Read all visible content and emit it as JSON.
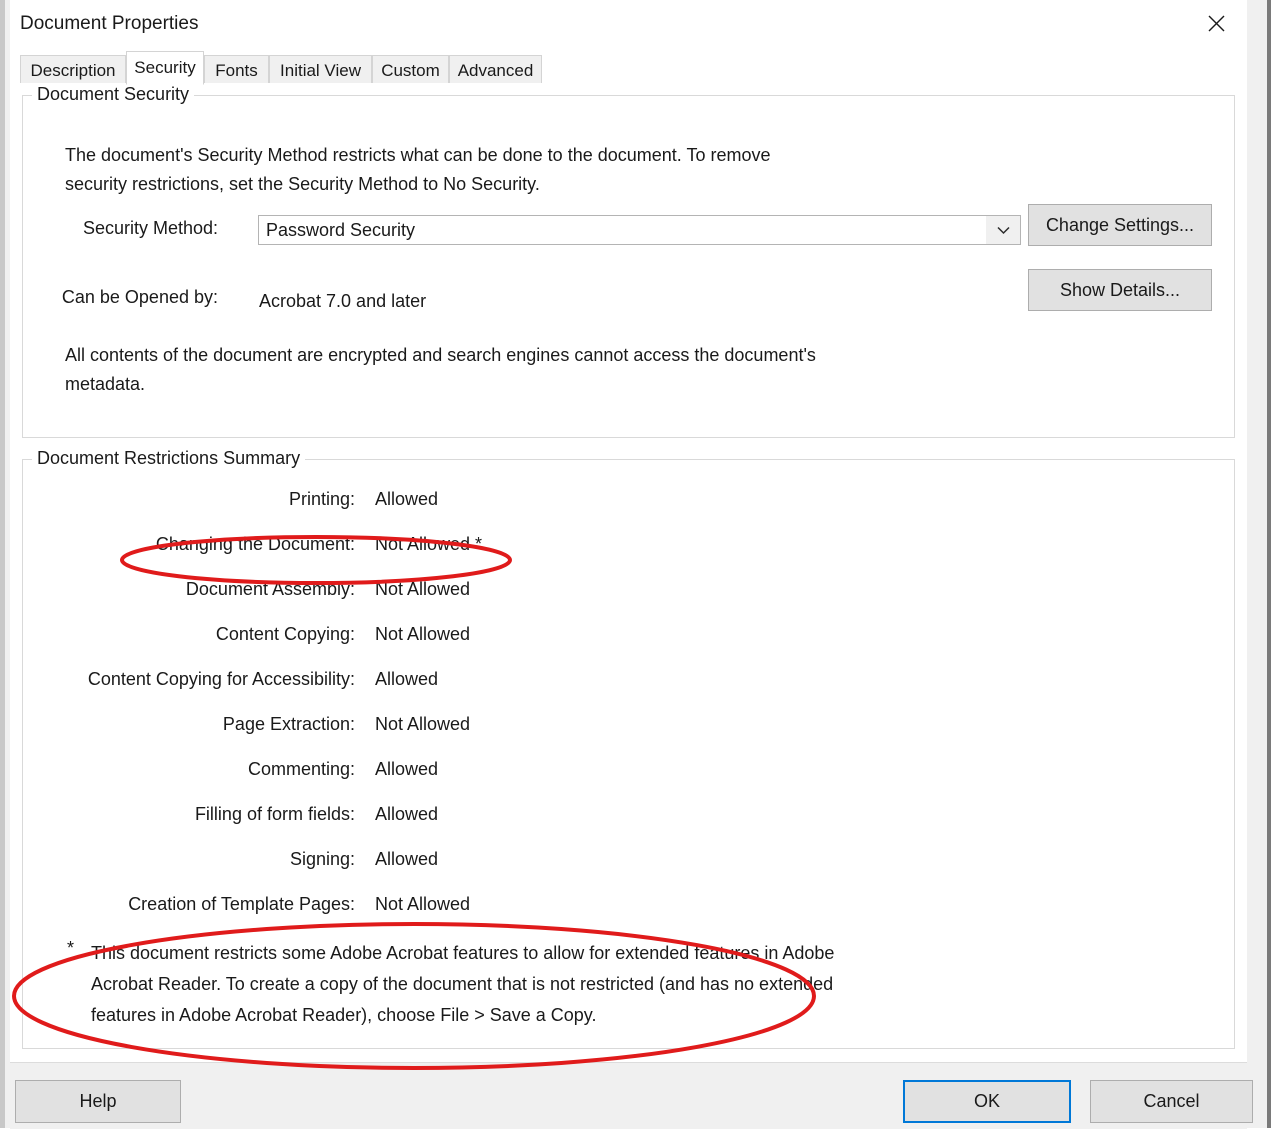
{
  "window": {
    "title": "Document Properties",
    "close_icon": "close-icon"
  },
  "tabs": [
    {
      "label": "Description",
      "selected": false
    },
    {
      "label": "Security",
      "selected": true
    },
    {
      "label": "Fonts",
      "selected": false
    },
    {
      "label": "Initial View",
      "selected": false
    },
    {
      "label": "Custom",
      "selected": false
    },
    {
      "label": "Advanced",
      "selected": false
    }
  ],
  "document_security": {
    "legend": "Document Security",
    "description_line1": "The document's Security Method restricts what can be done to the document. To remove",
    "description_line2": "security restrictions, set the Security Method to No Security.",
    "security_method_label": "Security Method:",
    "security_method_value": "Password Security",
    "security_method_dropdown_icon": "chevron-down-icon",
    "can_be_opened_by_label": "Can be Opened by:",
    "can_be_opened_by_value": "Acrobat 7.0 and later",
    "encryption_note_line1": "All contents of the document are encrypted and search engines cannot access the document's",
    "encryption_note_line2": "metadata.",
    "change_settings_label": "Change Settings...",
    "show_details_label": "Show Details..."
  },
  "restrictions": {
    "legend": "Document Restrictions Summary",
    "rows": [
      {
        "label": "Printing:",
        "value": "Allowed"
      },
      {
        "label": "Changing the Document:",
        "value": "Not Allowed *"
      },
      {
        "label": "Document Assembly:",
        "value": "Not Allowed"
      },
      {
        "label": "Content Copying:",
        "value": "Not Allowed"
      },
      {
        "label": "Content Copying for Accessibility:",
        "value": "Allowed"
      },
      {
        "label": "Page Extraction:",
        "value": "Not Allowed"
      },
      {
        "label": "Commenting:",
        "value": "Allowed"
      },
      {
        "label": "Filling of form fields:",
        "value": "Allowed"
      },
      {
        "label": "Signing:",
        "value": "Allowed"
      },
      {
        "label": "Creation of Template Pages:",
        "value": "Not Allowed"
      }
    ],
    "footnote_star": "*",
    "footnote_text": "This document restricts some Adobe Acrobat features to allow for extended features in Adobe Acrobat Reader. To create a copy of the document that is not restricted (and has no extended features in Adobe Acrobat Reader), choose File > Save a Copy."
  },
  "footer": {
    "help_label": "Help",
    "ok_label": "OK",
    "cancel_label": "Cancel"
  },
  "annotations": {
    "accent_color": "#e01b1b",
    "ellipse_changing_document": "highlights the Changing the Document restriction row",
    "ellipse_footnote": "highlights the extended features footnote paragraph"
  }
}
